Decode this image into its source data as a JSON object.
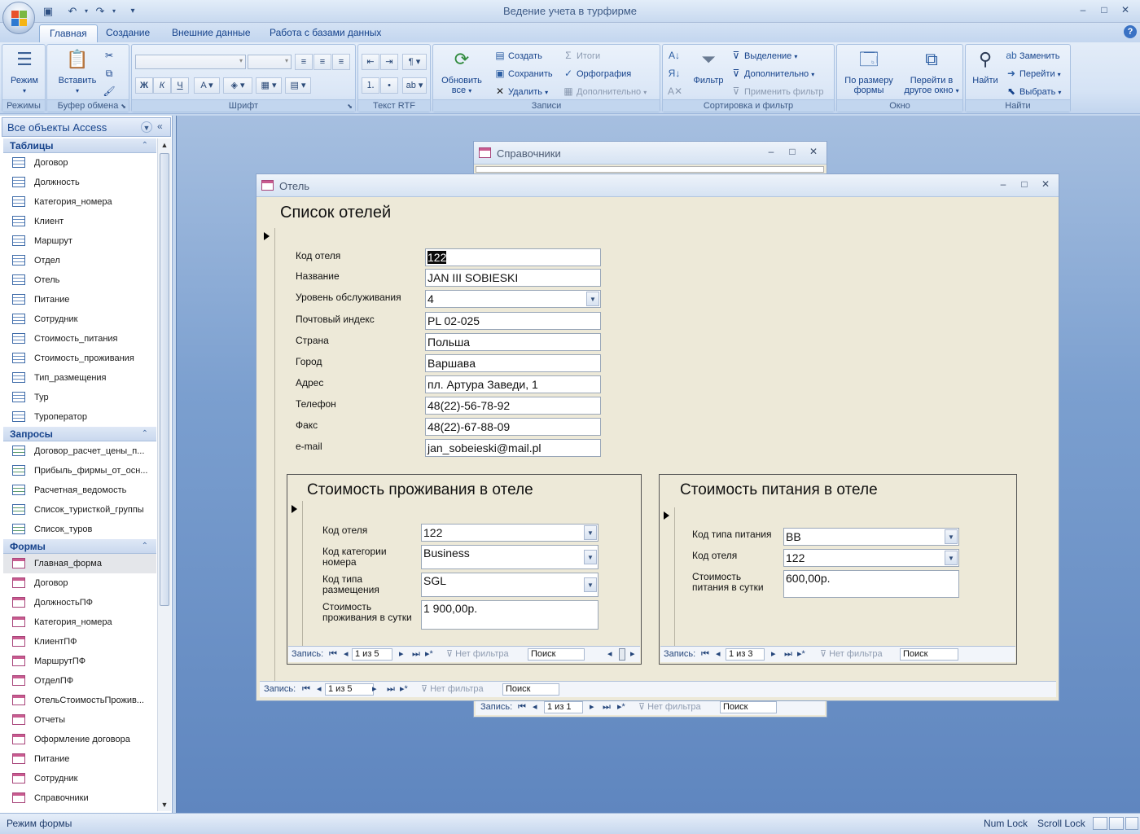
{
  "window": {
    "title": "Ведение учета в турфирме",
    "controls": {
      "minimize": "–",
      "maximize": "□",
      "close": "✕"
    }
  },
  "qat": {
    "save_icon": "save-icon",
    "undo_icon": "undo-icon",
    "redo_icon": "redo-icon",
    "customize_icon": "customize-icon"
  },
  "ribbon": {
    "tabs": [
      "Главная",
      "Создание",
      "Внешние данные",
      "Работа с базами данных"
    ],
    "active_tab": 0,
    "groups": {
      "modes": {
        "label": "Режимы",
        "mode": "Режим"
      },
      "clipboard": {
        "label": "Буфер обмена",
        "paste": "Вставить"
      },
      "font": {
        "label": "Шрифт"
      },
      "rtf": {
        "label": "Текст RTF"
      },
      "records": {
        "label": "Записи",
        "refresh": "Обновить все",
        "create": "Создать",
        "save": "Сохранить",
        "delete": "Удалить",
        "totals": "Итоги",
        "spelling": "Орфография",
        "more": "Дополнительно"
      },
      "sort": {
        "label": "Сортировка и фильтр",
        "filter": "Фильтр",
        "selection": "Выделение",
        "advanced": "Дополнительно",
        "apply": "Применить фильтр"
      },
      "window": {
        "label": "Окно",
        "fit": "По размеру формы",
        "switch": "Перейти в другое окно"
      },
      "find": {
        "label": "Найти",
        "find": "Найти",
        "replace": "Заменить",
        "goto": "Перейти",
        "select": "Выбрать"
      }
    }
  },
  "nav": {
    "header": "Все объекты Access",
    "sections": [
      {
        "title": "Таблицы",
        "type": "table",
        "items": [
          "Договор",
          "Должность",
          "Категория_номера",
          "Клиент",
          "Маршрут",
          "Отдел",
          "Отель",
          "Питание",
          "Сотрудник",
          "Стоимость_питания",
          "Стоимость_проживания",
          "Тип_размещения",
          "Тур",
          "Туроператор"
        ]
      },
      {
        "title": "Запросы",
        "type": "query",
        "items": [
          "Договор_расчет_цены_п...",
          "Прибыль_фирмы_от_осн...",
          "Расчетная_ведомость",
          "Список_туристкой_группы",
          "Список_туров"
        ]
      },
      {
        "title": "Формы",
        "type": "form",
        "items": [
          "Главная_форма",
          "Договор",
          "ДолжностьПФ",
          "Категория_номера",
          "КлиентПФ",
          "МаршрутПФ",
          "ОтделПФ",
          "ОтельСтоимостьПрожив...",
          "Отчеты",
          "Оформление договора",
          "Питание",
          "Сотрудник",
          "Справочники"
        ]
      }
    ],
    "selected_form": "Главная_форма"
  },
  "back_window": {
    "title": "Справочники",
    "nav": {
      "label": "Запись:",
      "record": "1 из 1",
      "filter": "Нет фильтра",
      "search": "Поиск"
    }
  },
  "hotel_window": {
    "title": "Отель",
    "heading": "Список отелей",
    "fields": [
      {
        "label": "Код отеля",
        "value": "122"
      },
      {
        "label": "Название",
        "value": "JAN III SOBIESKI"
      },
      {
        "label": "Уровень обслуживания",
        "value": "4"
      },
      {
        "label": "Почтовый индекс",
        "value": "PL 02-025"
      },
      {
        "label": "Страна",
        "value": "Польша"
      },
      {
        "label": "Город",
        "value": "Варшава"
      },
      {
        "label": "Адрес",
        "value": "пл. Артура Заведи, 1"
      },
      {
        "label": "Телефон",
        "value": "48(22)-56-78-92"
      },
      {
        "label": "Факс",
        "value": "48(22)-67-88-09"
      },
      {
        "label": "e-mail",
        "value": "jan_sobeieski@mail.pl"
      }
    ],
    "nav": {
      "label": "Запись:",
      "record": "1 из 5",
      "filter": "Нет фильтра",
      "search": "Поиск"
    }
  },
  "sub_living": {
    "title": "Стоимость проживания в отеле",
    "fields": [
      {
        "label": "Код отеля",
        "value": "122"
      },
      {
        "label": "Код категории номера",
        "value": "Business"
      },
      {
        "label": "Код типа размещения",
        "value": "SGL"
      },
      {
        "label": "Стоимость проживания в сутки",
        "value": "1 900,00р."
      }
    ],
    "nav": {
      "label": "Запись:",
      "record": "1 из 5",
      "filter": "Нет фильтра",
      "search": "Поиск"
    }
  },
  "sub_food": {
    "title": "Стоимость питания в отеле",
    "fields": [
      {
        "label": "Код типа питания",
        "value": "BB"
      },
      {
        "label": "Код отеля",
        "value": "122"
      },
      {
        "label": "Стоимость питания в сутки",
        "value": "600,00р."
      }
    ],
    "nav": {
      "label": "Запись:",
      "record": "1 из 3",
      "filter": "Нет фильтра",
      "search": "Поиск"
    }
  },
  "status": {
    "mode": "Режим формы",
    "num": "Num Lock",
    "scroll": "Scroll Lock"
  }
}
